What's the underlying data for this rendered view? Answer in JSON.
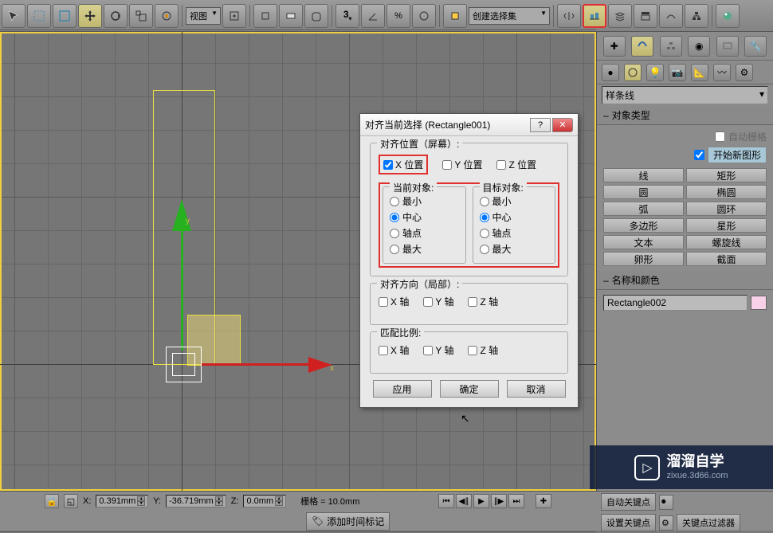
{
  "toolbar": {
    "view_dropdown": "视图",
    "create_set": "创建选择集"
  },
  "dialog": {
    "title": "对齐当前选择 (Rectangle001)",
    "align_pos_label": "对齐位置（屏幕）:",
    "x_pos": "X 位置",
    "y_pos": "Y 位置",
    "z_pos": "Z 位置",
    "current_obj": "当前对象:",
    "target_obj": "目标对象:",
    "min": "最小",
    "center": "中心",
    "pivot": "轴点",
    "max": "最大",
    "align_dir_label": "对齐方向（局部）:",
    "x_axis": "X 轴",
    "y_axis": "Y 轴",
    "z_axis": "Z 轴",
    "match_scale_label": "匹配比例:",
    "apply": "应用",
    "ok": "确定",
    "cancel": "取消"
  },
  "right": {
    "spline_header": "样条线",
    "obj_type": "对象类型",
    "auto_grid": "自动栅格",
    "new_shape": "开始新图形",
    "shapes": {
      "line": "线",
      "rect": "矩形",
      "circle": "圆",
      "ellipse": "椭圆",
      "arc": "弧",
      "ring": "圆环",
      "poly": "多边形",
      "star": "星形",
      "text": "文本",
      "helix": "螺旋线",
      "egg": "卵形",
      "section": "截面"
    },
    "name_color": "名称和颜色",
    "obj_name": "Rectangle002"
  },
  "bottom": {
    "x_label": "X:",
    "x_val": "0.391mm",
    "y_label": "Y:",
    "y_val": "-36.719mm",
    "z_label": "Z:",
    "z_val": "0.0mm",
    "grid_label": "栅格 = 10.0mm",
    "add_time": "添加时间标记",
    "auto_key": "自动关键点",
    "set_key": "设置关键点",
    "key_filter": "关键点过滤器"
  },
  "watermark": {
    "title": "溜溜自学",
    "url": "zixue.3d66.com"
  }
}
